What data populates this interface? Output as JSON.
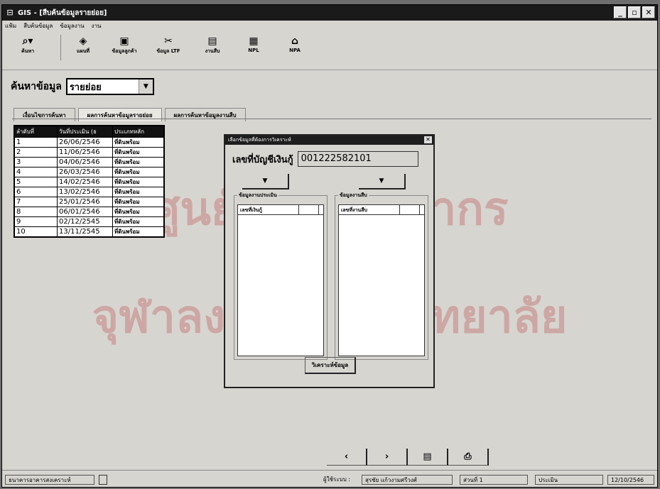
{
  "window": {
    "title": "GIS - [สืบค้นข้อมูลรายย่อย]",
    "controls": [
      "_",
      "▫",
      "✕"
    ]
  },
  "menu": [
    "แฟ้ม",
    "สืบค้นข้อมูล",
    "ข้อมูลงาน",
    "งาน"
  ],
  "toolbar": [
    {
      "label": "ค้นหา",
      "icon": "search-icon"
    },
    {
      "label": "แผนที่",
      "icon": "map-icon"
    },
    {
      "label": "ข้อมูลลูกค้า",
      "icon": "customer-icon"
    },
    {
      "label": "ข้อมูล LTF",
      "icon": "ltf-icon"
    },
    {
      "label": "งานสืบ",
      "icon": "investigation-icon"
    },
    {
      "label": "NPL",
      "icon": "npl-icon"
    },
    {
      "label": "NPA",
      "icon": "npa-icon"
    }
  ],
  "search": {
    "label": "ค้นหาข้อมูล",
    "value": "รายย่อย"
  },
  "tabs": [
    "เงื่อนไขการค้นหา",
    "ผลการค้นหาข้อมูลรายย่อย",
    "ผลการค้นหาข้อมูลงานสืบ"
  ],
  "grid": {
    "headers": [
      "ลำดับที่",
      "วันที่ประเมิน (ธ",
      "ประเภทหลัก"
    ],
    "rows": [
      [
        "1",
        "26/06/2546",
        "ที่ดินพร้อม"
      ],
      [
        "2",
        "11/06/2546",
        "ที่ดินพร้อม"
      ],
      [
        "3",
        "04/06/2546",
        "ที่ดินพร้อม"
      ],
      [
        "4",
        "26/03/2546",
        "ที่ดินพร้อม"
      ],
      [
        "5",
        "14/02/2546",
        "ที่ดินพร้อม"
      ],
      [
        "6",
        "13/02/2546",
        "ที่ดินพร้อม"
      ],
      [
        "7",
        "25/01/2546",
        "ที่ดินพร้อม"
      ],
      [
        "8",
        "06/01/2546",
        "ที่ดินพร้อม"
      ],
      [
        "9",
        "02/12/2545",
        "ที่ดินพร้อม"
      ],
      [
        "10",
        "13/11/2545",
        "ที่ดินพร้อม"
      ]
    ]
  },
  "dialog": {
    "title": "เลือกข้อมูลที่ต้องการวิเคราะห์",
    "account_label": "เลขที่บัญชีเงินกู้",
    "account_value": "001222582101",
    "group_left": "ข้อมูลงานประเมิน",
    "group_left_col": "เลขที่เงินกู้",
    "group_right": "ข้อมูลงานสืบ",
    "group_right_col": "เลขที่งานสืบ",
    "analyze_label": "วิเคราะห์ข้อมูล"
  },
  "nav": [
    "‹",
    "›",
    "▤",
    "⎙"
  ],
  "status": {
    "bank": "ธนาคารอาคารสงเคราะห์",
    "user_label": "ผู้ใช้ระบบ :",
    "user": "สุรชัย แก้วงามศรีวงศ์",
    "section": "ส่วนที่ 1",
    "dept": "ประเมิน",
    "date": "12/10/2546"
  },
  "watermark": {
    "line1": "ศูนย์วิทยทรัพยากร",
    "line2": "จุฬาลงกรณ์มหาวิทยาลัย"
  }
}
